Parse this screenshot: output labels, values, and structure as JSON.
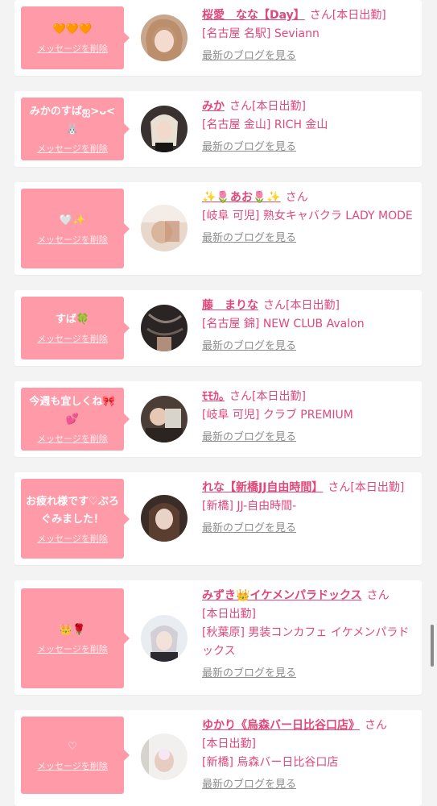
{
  "delete_label": "メッセージを削除",
  "blog_label": "最新のブログを見る",
  "san_label": "さん",
  "colors": {
    "accent": "#e0487a",
    "bubble": "#ff9aa8",
    "muted": "#8c8c8c"
  },
  "entries": [
    {
      "message": "🧡🧡🧡",
      "name": "桜愛　なな【Day】",
      "status": "[本日出勤]",
      "shop": "[名古屋 名駅] Seviann"
    },
    {
      "message": "みかのすばஐ>ᴗ<🐰",
      "name": "みか",
      "status": "[本日出勤]",
      "shop": "[名古屋 金山] RICH 金山"
    },
    {
      "message": "🤍✨",
      "name": "✨🌷あお🌷✨",
      "status": "",
      "shop": "[岐阜 可児] 熟女キャバクラ LADY MODE"
    },
    {
      "message": "すば🍀",
      "name": "藤　まりな",
      "status": "[本日出勤]",
      "shop": "[名古屋 錦] NEW CLUB Avalon"
    },
    {
      "message": "今週も宜しくね🎀💕",
      "name": "ﾓﾓｶ｡",
      "status": "[本日出勤]",
      "shop": "[岐阜 可児] クラブ PREMIUM"
    },
    {
      "message": "お疲れ様です♡ぷろぐみました！",
      "name": "れな【新橋JJ自由時間】",
      "status": "[本日出勤]",
      "shop": "[新橋] JJ-自由時間-"
    },
    {
      "message": "👑🌹",
      "name": "みずき👑イケメンパラドックス",
      "status": "[本日出勤]",
      "shop": "[秋葉原] 男装コンカフェ イケメンパラドックス"
    },
    {
      "message": "♡",
      "name": "ゆかり《烏森バー日比谷口店》",
      "status": "[本日出勤]",
      "shop": "[新橋] 烏森バー日比谷口店"
    }
  ]
}
